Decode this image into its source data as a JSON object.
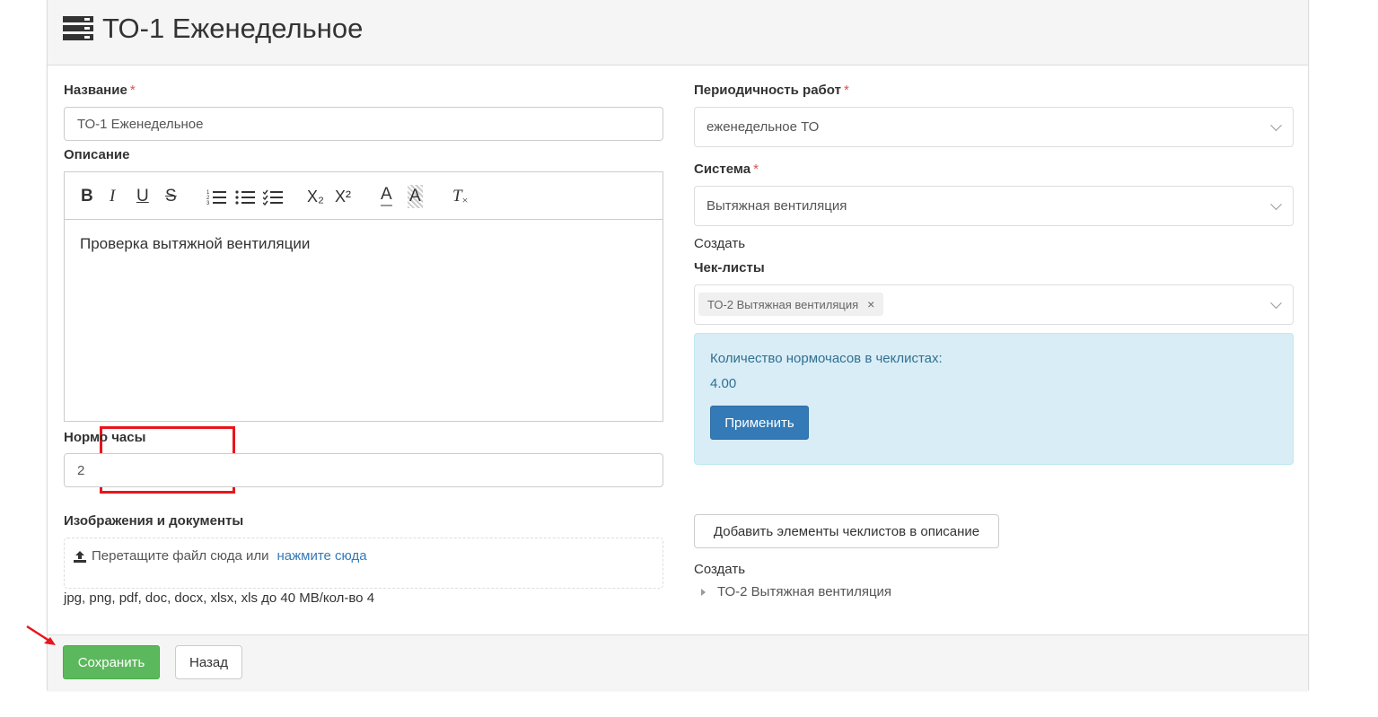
{
  "header": {
    "title": "ТО-1 Еженедельное",
    "icon": "server-icon"
  },
  "form": {
    "name": {
      "label": "Название",
      "value": "ТО-1 Еженедельное"
    },
    "description": {
      "label": "Описание",
      "text": "Проверка вытяжной вентиляции",
      "toolbar": {
        "bold": "B",
        "italic": "I",
        "underline": "U",
        "strike": "S",
        "subscript": "X₂",
        "superscript": "X²",
        "font_color": "A",
        "bg_color": "A",
        "clear": "T"
      }
    },
    "norm_hours": {
      "label": "Нормо часы",
      "value": "2"
    },
    "files": {
      "label": "Изображения и документы",
      "drop_text": "Перетащите файл сюда или",
      "drop_link": "нажмите сюда",
      "hint": "jpg, png, pdf, doc, docx, xlsx, xls до 40 MB/кол-во 4"
    },
    "periodicity": {
      "label": "Периодичность работ",
      "value": "еженедельное ТО"
    },
    "system": {
      "label": "Система",
      "value": "Вытяжная вентиляция",
      "create_link": "Создать"
    },
    "checklists": {
      "label": "Чек-листы",
      "tags": [
        "ТО-2 Вытяжная вентиляция"
      ],
      "tag_remove": "×"
    },
    "norm_info": {
      "text": "Количество нормочасов в чеклистах:",
      "value": "4.00",
      "apply_label": "Применить"
    },
    "add_items_label": "Добавить элементы чеклистов в описание",
    "create_link2": "Создать",
    "tree": [
      "ТО-2 Вытяжная вентиляция"
    ]
  },
  "footer": {
    "save_label": "Сохранить",
    "back_label": "Назад"
  },
  "colors": {
    "primary": "#337ab7",
    "success": "#5cb85c",
    "info_bg": "#d9edf7",
    "highlight": "#e8151b",
    "required": "#d9534f"
  }
}
